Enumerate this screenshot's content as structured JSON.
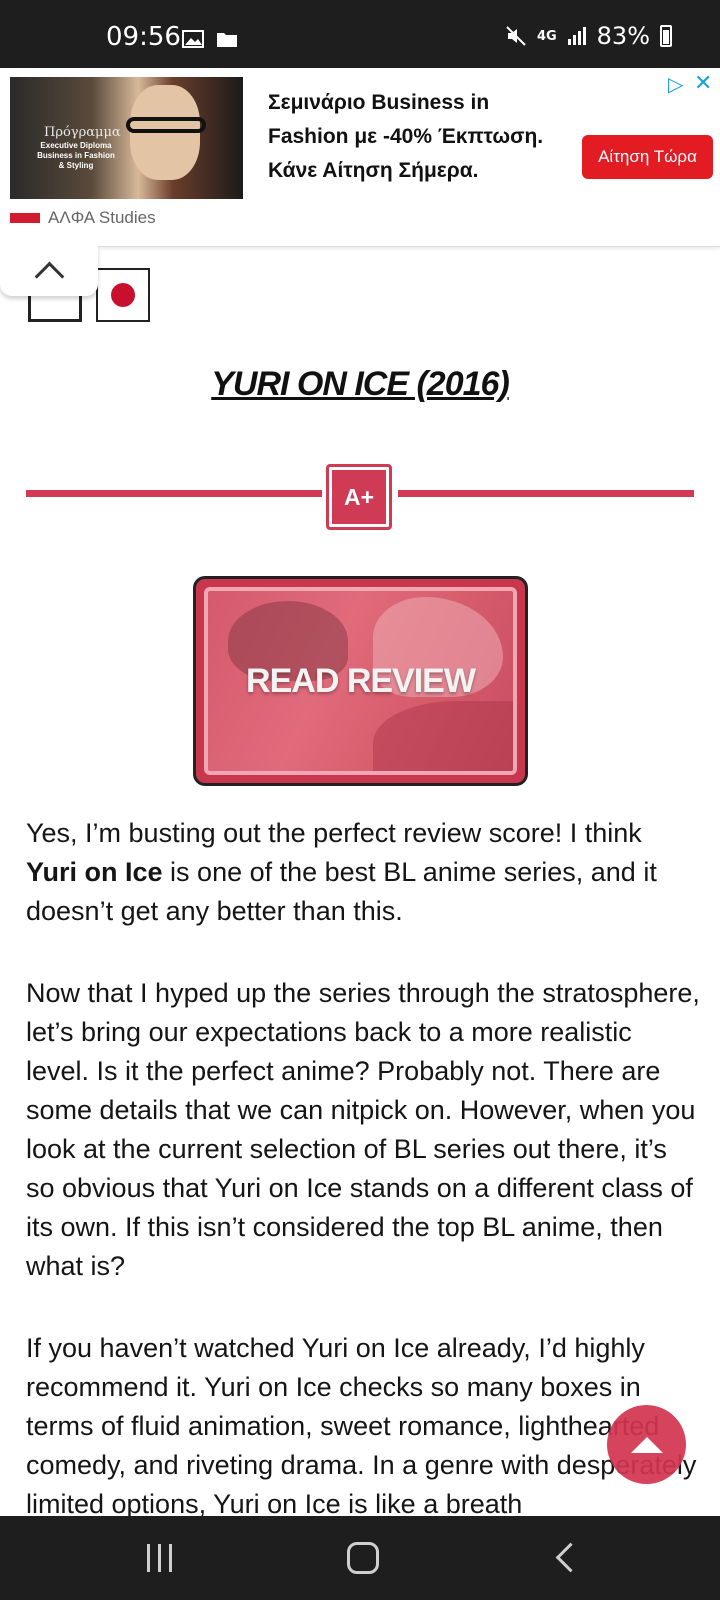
{
  "status_bar": {
    "time": "09:56",
    "network": "4G",
    "battery": "83%",
    "icons": [
      "image-icon",
      "folder-icon",
      "mute-icon",
      "signal-icon",
      "battery-icon"
    ]
  },
  "ad": {
    "image_title": "Πρόγραμμα",
    "image_subtitle": "Executive Diploma Business in Fashion & Styling",
    "brand": "ΑΛΦΑ Studies",
    "text": "Σεμινάριο Business in Fashion με -40% Έκπτωση. Κάνε Αίτηση Σήμερα.",
    "cta": "Αίτηση Τώρα",
    "adchoices": "▷",
    "close": "✕"
  },
  "post": {
    "title": "YURI ON ICE (2016)",
    "grade": "A+",
    "review_button": "READ REVIEW",
    "paragraph1_pre": "Yes, I’m busting out the perfect review score! I think ",
    "paragraph1_bold": "Yuri on Ice",
    "paragraph1_post": " is one of the best BL anime series, and it doesn’t get any better than this.",
    "paragraph2": "Now that I hyped up the series through the stratosphere, let’s bring our expectations back to a more realistic level. Is it the perfect anime? Probably not. There are some details that we can nitpick on. However, when you look at the current selection of BL series out there, it’s so obvious that Yuri on Ice stands on a different class of its own. If this isn’t considered the top BL anime, then what is?",
    "paragraph3": "If you haven’t watched Yuri on Ice already, I’d highly recommend it. Yuri on Ice checks so many boxes in terms of fluid animation, sweet romance, lighthearted comedy, and riveting drama. In a genre with desperately limited options, Yuri on Ice is like a breath"
  },
  "colors": {
    "accent": "#d2354f",
    "ad_cta": "#e31b23",
    "status_bar": "#1e1e1e"
  }
}
